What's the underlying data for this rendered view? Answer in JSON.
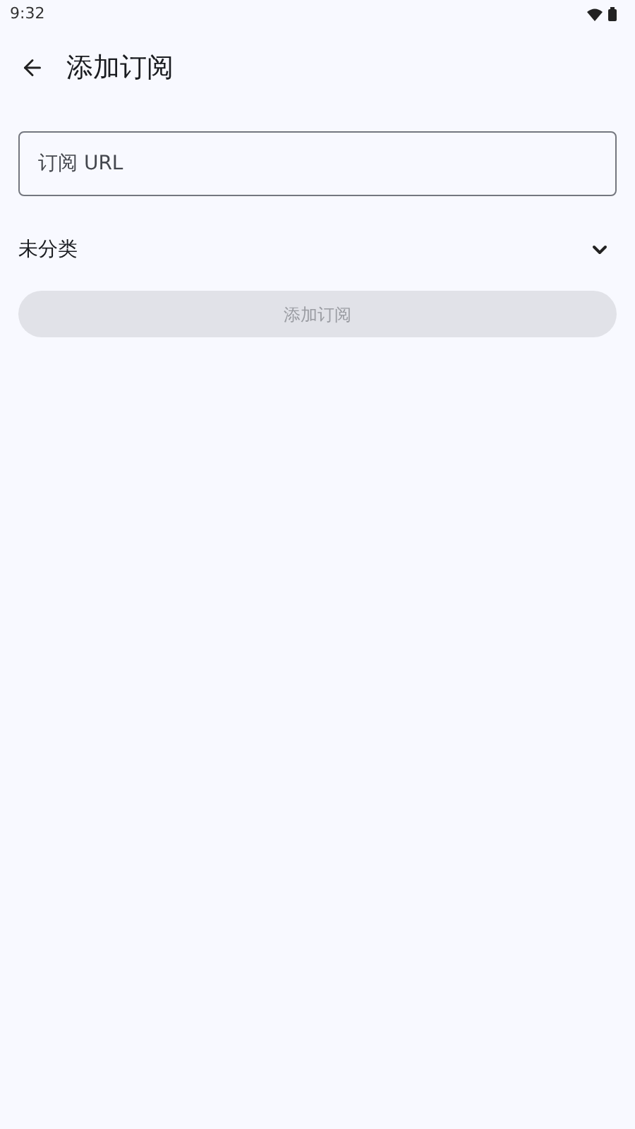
{
  "status_bar": {
    "time": "9:32"
  },
  "header": {
    "title": "添加订阅"
  },
  "url_field": {
    "placeholder": "订阅 URL"
  },
  "category_select": {
    "value": "未分类",
    "expanded": false
  },
  "submit_button": {
    "label": "添加订阅",
    "disabled": true
  }
}
